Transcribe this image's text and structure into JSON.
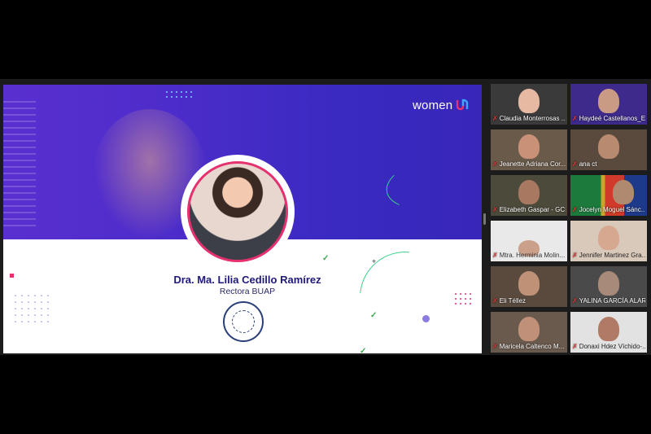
{
  "shared_screen": {
    "logo_text": "women",
    "speaker_name": "Dra. Ma. Lilia Cedillo Ramírez",
    "speaker_role": "Rectora BUAP",
    "colors": {
      "banner": "#4a2cc9",
      "accent_pink": "#e5316f",
      "name_text": "#1f1a7a",
      "check_green": "#3aa84e"
    }
  },
  "participants": [
    {
      "name": "Claudia Monterrosas ...",
      "muted": true
    },
    {
      "name": "Haydeé Castellanos_E...",
      "muted": true
    },
    {
      "name": "Jeanette Adriana Cor...",
      "muted": true
    },
    {
      "name": "ana ct",
      "muted": true
    },
    {
      "name": "Elizabeth Gaspar - GCI",
      "muted": true
    },
    {
      "name": "Jocelyn Moguel Sánc...",
      "muted": true
    },
    {
      "name": "Mtra. Herminia Molin...",
      "muted": true
    },
    {
      "name": "Jennifer Martinez Gra...",
      "muted": true
    },
    {
      "name": "Eli Téllez",
      "muted": true
    },
    {
      "name": "YALINA GARCÍA ALAR...",
      "muted": true
    },
    {
      "name": "Maricela Caltenco M...",
      "muted": true
    },
    {
      "name": "Donaxi Hdez Víchido-...",
      "muted": true
    }
  ]
}
